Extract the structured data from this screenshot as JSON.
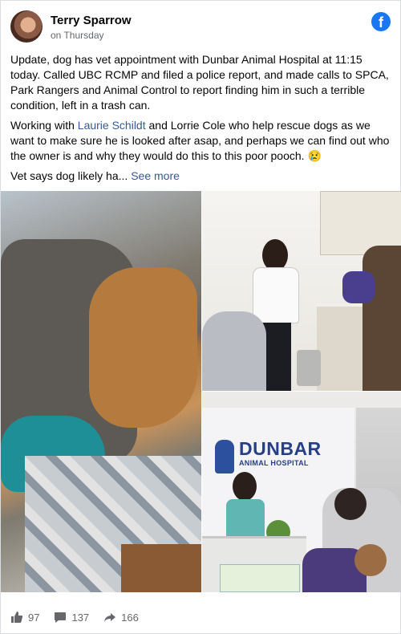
{
  "post": {
    "author": "Terry Sparrow",
    "timestamp": "on Thursday",
    "platform_icon": "facebook-icon",
    "para1": "Update, dog has vet appointment with Dunbar Animal Hospital at 11:15 today. Called UBC RCMP and filed a police report, and made calls to SPCA, Park Rangers and Animal Control to report finding him in such a terrible condition, left in a trash can.",
    "para2_prefix": "Working with ",
    "para2_link": "Laurie Schildt",
    "para2_rest": " and Lorrie Cole who help rescue dogs as we want to make sure he is looked after asap, and perhaps we can find out who the owner is and why they would do this to this poor pooch. 😢",
    "para3_prefix": "Vet says dog likely ha...",
    "see_more": "See more"
  },
  "photos": {
    "clinic_sign_title": "DUNBAR",
    "clinic_sign_subtitle": "ANIMAL HOSPITAL"
  },
  "stats": {
    "likes": "97",
    "comments": "137",
    "shares": "166"
  },
  "colors": {
    "brand": "#1877f2",
    "link": "#385898",
    "meta": "#65676b"
  }
}
